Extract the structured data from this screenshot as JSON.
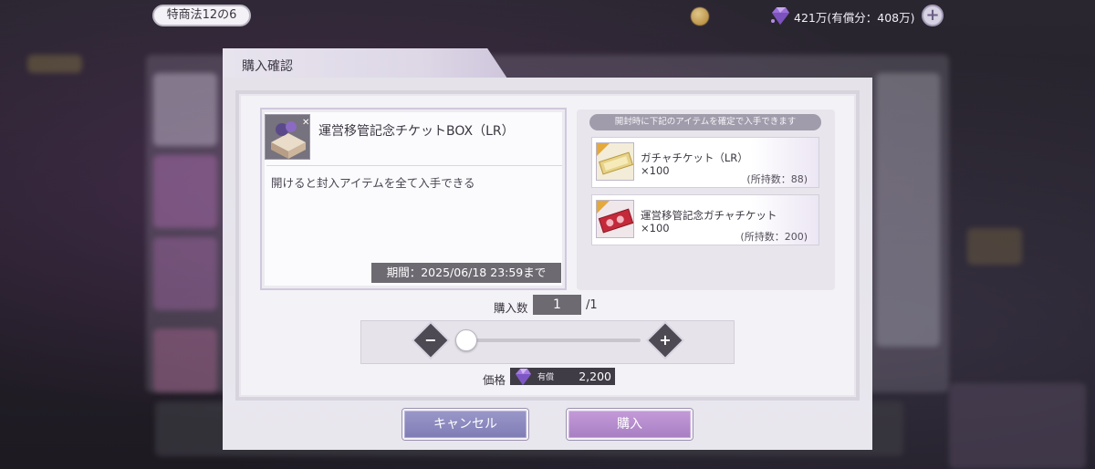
{
  "top_bar": {
    "law_label": "特商法12の6",
    "gem_balance": "421万(有償分：408万)"
  },
  "dialog": {
    "title": "購入確認",
    "item": {
      "name": "運営移管記念チケットBOX（LR）",
      "description": "開けると封入アイテムを全て入手できる",
      "period": "期間：2025/06/18 23:59まで"
    },
    "contents": {
      "header": "開封時に下記のアイテムを確定で入手できます",
      "rewards": [
        {
          "name": "ガチャチケット（LR）",
          "qty": "×100",
          "owned": "(所持数：88)"
        },
        {
          "name": "運営移管記念ガチャチケット",
          "qty": "×100",
          "owned": "(所持数：200)"
        }
      ]
    },
    "quantity": {
      "label": "購入数",
      "value": "1",
      "max": "/1",
      "slider_fraction": 0
    },
    "price": {
      "label": "価格",
      "currency_tag": "有償",
      "value": "2,200"
    },
    "buttons": {
      "cancel": "キャンセル",
      "buy": "購入"
    }
  },
  "colors": {
    "cancel_button": "#8a88c0",
    "buy_button": "#b88ccf",
    "gem": "#9b6fd6"
  }
}
